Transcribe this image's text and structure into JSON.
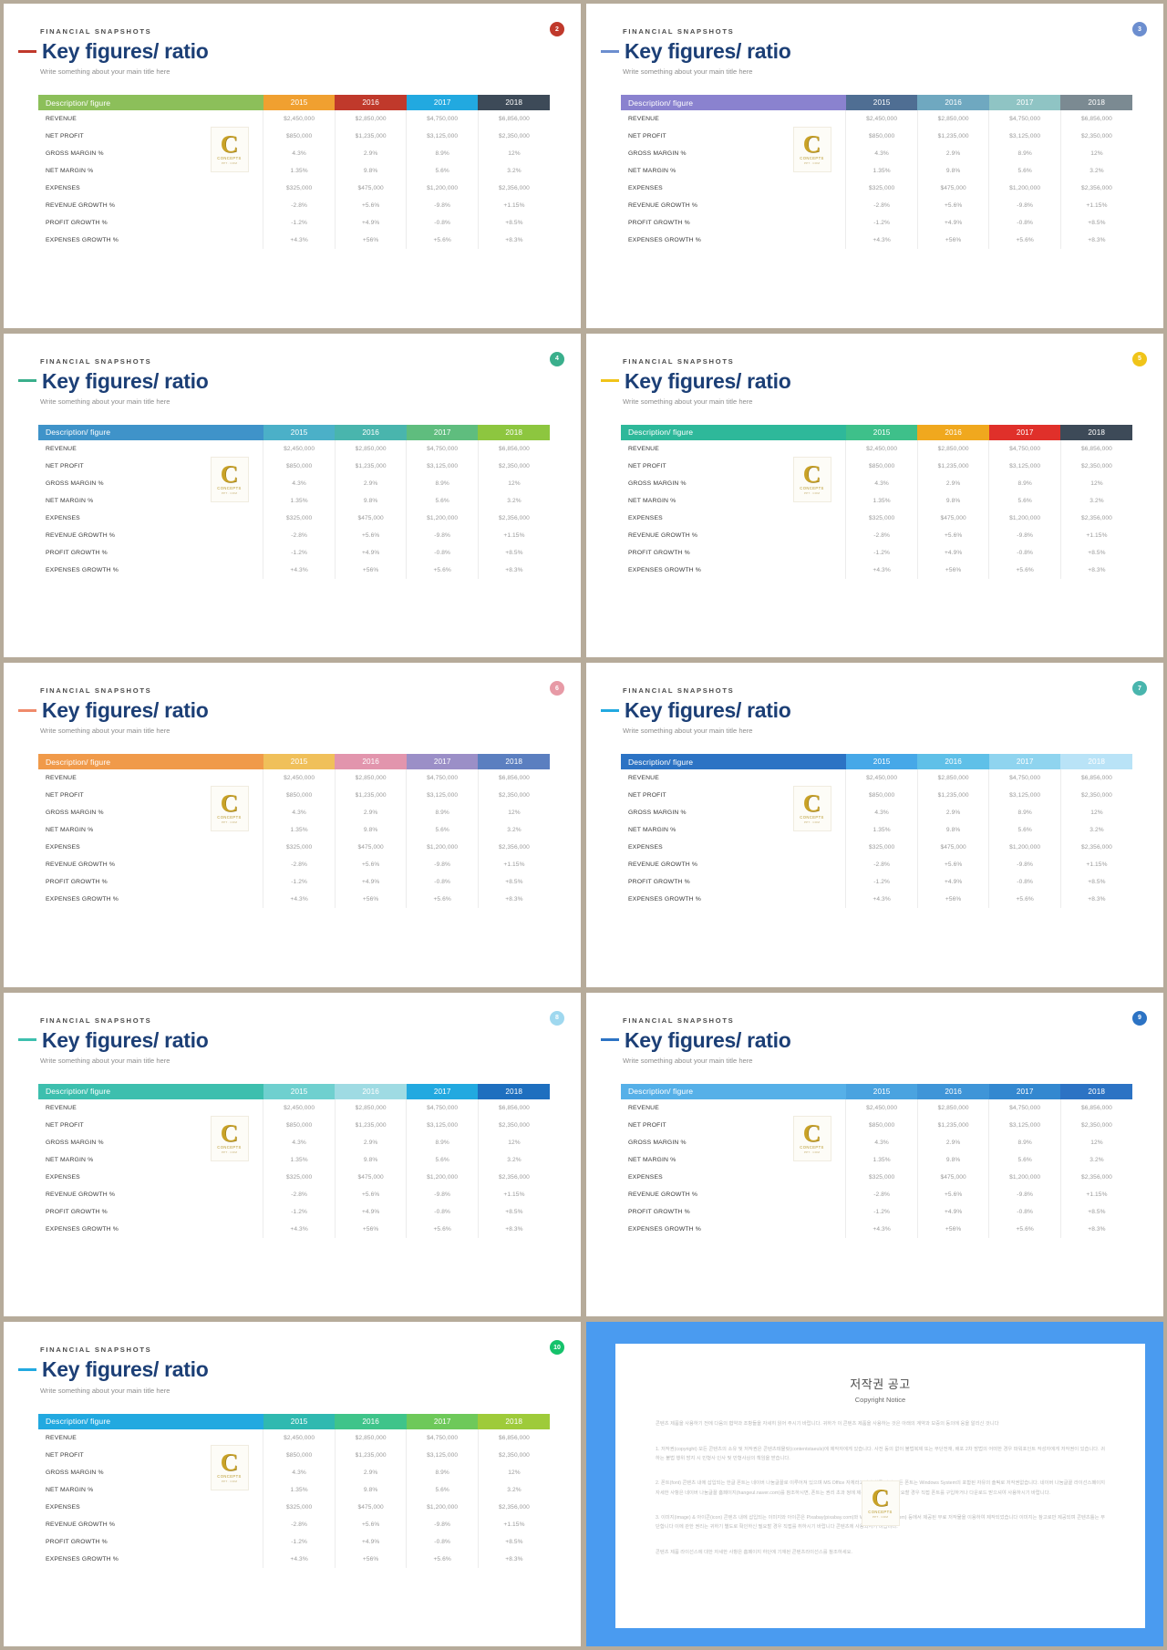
{
  "deck": {
    "eyebrow": "FINANCIAL SNAPSHOTS",
    "title": "Key figures/ ratio",
    "subtitle": "Write something about your main title here",
    "watermark": {
      "letter": "C",
      "line1": "CONCEPTS",
      "line2": "PPT . COM"
    }
  },
  "table": {
    "columns": [
      "Description/ figure",
      "2015",
      "2016",
      "2017",
      "2018"
    ],
    "rows": [
      {
        "label": "REVENUE",
        "values": [
          "$2,450,000",
          "$2,850,000",
          "$4,750,000",
          "$6,856,000"
        ]
      },
      {
        "label": "NET PROFIT",
        "values": [
          "$850,000",
          "$1,235,000",
          "$3,125,000",
          "$2,350,000"
        ]
      },
      {
        "label": "GROSS MARGIN %",
        "values": [
          "4.3%",
          "2.9%",
          "8.9%",
          "12%"
        ]
      },
      {
        "label": "NET MARGIN %",
        "values": [
          "1.35%",
          "9.8%",
          "5.6%",
          "3.2%"
        ]
      },
      {
        "label": "EXPENSES",
        "values": [
          "$325,000",
          "$475,000",
          "$1,200,000",
          "$2,356,000"
        ]
      },
      {
        "label": "REVENUE GROWTH %",
        "values": [
          "-2.8%",
          "+5.6%",
          "-9.8%",
          "+1.15%"
        ]
      },
      {
        "label": "PROFIT GROWTH %",
        "values": [
          "-1.2%",
          "+4.9%",
          "-0.8%",
          "+8.5%"
        ]
      },
      {
        "label": "EXPENSES GROWTH %",
        "values": [
          "+4.3%",
          "+56%",
          "+5.6%",
          "+8.3%"
        ]
      }
    ]
  },
  "slides": [
    {
      "badge": "2",
      "badge_color": "#c0392b",
      "dash_color": "#c0392b",
      "header_colors": [
        "#8cbf5a",
        "#f0a030",
        "#c0392b",
        "#22a9e0",
        "#3d4a58"
      ]
    },
    {
      "badge": "3",
      "badge_color": "#6c8ecf",
      "dash_color": "#6c8ecf",
      "header_colors": [
        "#8a82cf",
        "#4f6e93",
        "#6fa8c0",
        "#8fc4c4",
        "#7b8a92"
      ]
    },
    {
      "badge": "4",
      "badge_color": "#3aaf8c",
      "dash_color": "#3aaf8c",
      "header_colors": [
        "#3f93c9",
        "#4bb0c8",
        "#49b5ad",
        "#5fbd7e",
        "#8dc63f"
      ]
    },
    {
      "badge": "5",
      "badge_color": "#f0c419",
      "dash_color": "#f0c419",
      "header_colors": [
        "#2eb89a",
        "#3ec08a",
        "#f0a81e",
        "#e0302a",
        "#3d4a58"
      ]
    },
    {
      "badge": "6",
      "badge_color": "#e79aa6",
      "dash_color": "#ef8a6b",
      "header_colors": [
        "#f09a4a",
        "#f0c05a",
        "#e295ad",
        "#9b8fc7",
        "#5b7fc0"
      ]
    },
    {
      "badge": "7",
      "badge_color": "#49b5ad",
      "dash_color": "#22a9e0",
      "header_colors": [
        "#2c73c4",
        "#46a8e8",
        "#5fc0e8",
        "#8fd4ef",
        "#b9e3f7"
      ]
    },
    {
      "badge": "8",
      "badge_color": "#9fd8ef",
      "dash_color": "#3dbfae",
      "header_colors": [
        "#3dbfae",
        "#6fd0cf",
        "#9fdbe3",
        "#22a9e0",
        "#1e6fbf"
      ]
    },
    {
      "badge": "9",
      "badge_color": "#2c73c4",
      "dash_color": "#2c73c4",
      "header_colors": [
        "#56b0e8",
        "#4aa3e0",
        "#3f95d8",
        "#3388d0",
        "#2c73c4"
      ]
    },
    {
      "badge": "10",
      "badge_color": "#15c26b",
      "dash_color": "#22a9e0",
      "header_colors": [
        "#22a9e0",
        "#2fb9b0",
        "#3fc48a",
        "#6ec95a",
        "#9ecb3a"
      ]
    }
  ],
  "copyright": {
    "title": "저작권 공고",
    "subtitle": "Copyright Notice",
    "paragraphs": [
      "콘텐츠 제품을 사용하기 전에 다음의 협약과 조항들을 자세히 읽어 주시기 바랍니다. 귀하가 이 콘텐츠 제품을 사용하는 것은 아래의 계약과 보증의 동의에 응을 알리신 것니다",
      "1. 저작권(copyright) 모든 콘텐츠의 소유 및 저작권은 콘텐츠테믈릿(contentstaeuls)에 제작자에게 있습니다. 사전 동의 없이 불법복제 또는 무단전재, 배포 2차 방법의 어떠한 경우 파워포인트 작성자에게 저작권이 있습니다. 귀하는 불법 행위 방지 시 민형사 인사 및 민형사상의 책임을 받습니다.",
      "2. 폰트(font) 콘텐츠 내에 삽입되는 한글 폰트는 네이버 나눔글꼴로 이루어져 있으며 MS Office 자체라고난다 한글 피피 모든 폰트는 Windows System의 포함된 자유의 솔픽로 저작권없습니다. 네이버 나눔글꼴 라이선스페이지 자세한 사항은 네이버 나눔글꼴 홈페이지(hangeul.naver.com)를 참조하시면, 폰트는 권리 초과 정에 제공되기 않으므로, 필요할 경우 직접 폰트를 구입하거나 다운로드 받으셔야 사용하시기 바랍니다.",
      "3. 이미지(image) & 아이콘(icon) 콘텐츠 내에 삽입되는 이미지와 아이콘은 Pixabay(pixabay.com)와 Webpiscinetails(.com) 등에서 제공된 무료 저작물을 이용하여 제작되었습니다 이미지는 참고로만 제공되며 콘텐츠틀는 무단합니다 이에 관한 권리는 귀하기 별도로 확인하신 필요할 경우 직접를 취하시기 바랍니다 콘텐츠에 사용되시기 바랍니다.",
      "콘텐츠 제품 라이선스에 대한 자세한 사항은 홈페이지 하단에 기재된 콘텐츠라이선스를 참조하세요."
    ]
  }
}
